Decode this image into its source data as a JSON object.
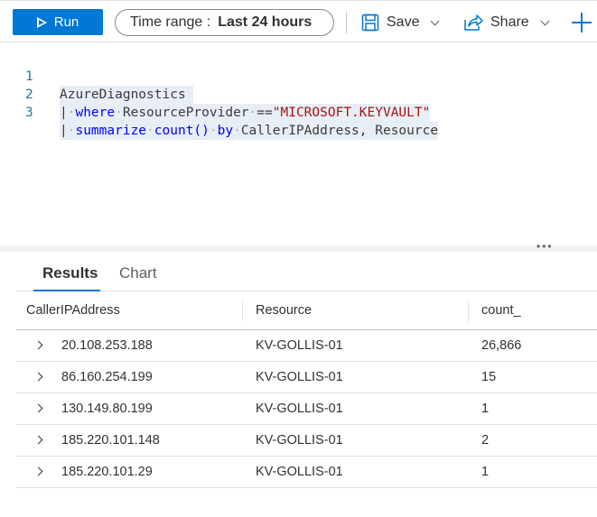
{
  "toolbar": {
    "run_label": "Run",
    "time_range_label": "Time range :",
    "time_range_value": "Last 24 hours",
    "save_label": "Save",
    "share_label": "Share"
  },
  "editor": {
    "lines": [
      {
        "number": "1",
        "tokens": [
          "AzureDiagnostics"
        ]
      },
      {
        "number": "2",
        "pipe": "|",
        "keyword": "where",
        "field": "ResourceProvider",
        "operator": "==",
        "string": "\"MICROSOFT.KEYVAULT\""
      },
      {
        "number": "3",
        "pipe": "|",
        "keyword": "summarize",
        "func": "count()",
        "by": "by",
        "rest": "CallerIPAddress, Resource"
      }
    ]
  },
  "results": {
    "tabs": [
      {
        "label": "Results",
        "active": true
      },
      {
        "label": "Chart",
        "active": false
      }
    ],
    "columns": [
      "CallerIPAddress",
      "Resource",
      "count_"
    ],
    "rows": [
      [
        "20.108.253.188",
        "KV-GOLLIS-01",
        "26,866"
      ],
      [
        "86.160.254.199",
        "KV-GOLLIS-01",
        "15"
      ],
      [
        "130.149.80.199",
        "KV-GOLLIS-01",
        "1"
      ],
      [
        "185.220.101.148",
        "KV-GOLLIS-01",
        "2"
      ],
      [
        "185.220.101.29",
        "KV-GOLLIS-01",
        "1"
      ]
    ]
  },
  "icons": {
    "run": "play-icon",
    "save": "floppy-disk-icon",
    "share": "share-arrow-icon",
    "new": "plus-icon",
    "more": "ellipsis-icon",
    "expand": "chevron-right-icon"
  }
}
